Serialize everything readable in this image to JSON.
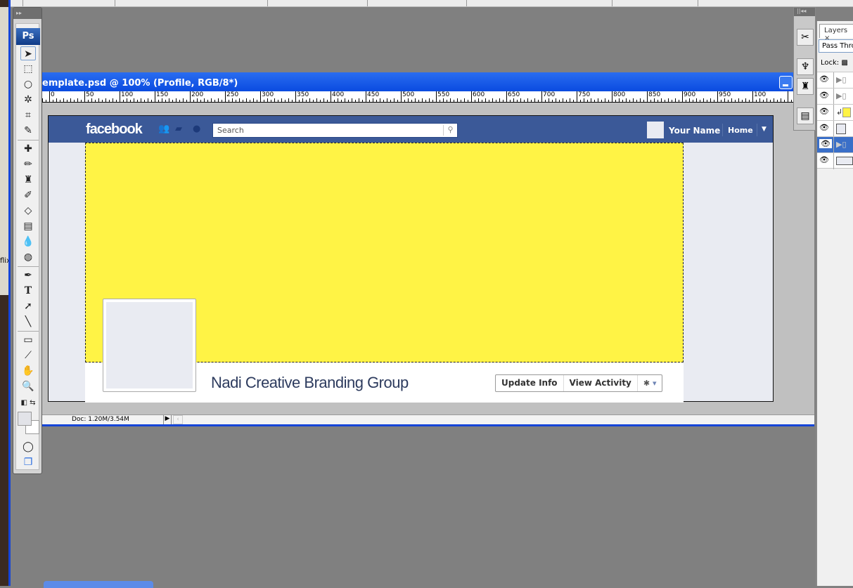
{
  "document": {
    "title": "emplate.psd @ 100% (Profile, RGB/8*)",
    "ruler_labels": [
      "0",
      "50",
      "100",
      "150",
      "200",
      "250",
      "300",
      "350",
      "400",
      "450",
      "500",
      "550",
      "600",
      "650",
      "700",
      "750",
      "800",
      "850",
      "900",
      "950",
      "100"
    ],
    "status_doc": "Doc: 1.20M/3.54M"
  },
  "desktop": {
    "partial_text": "flix"
  },
  "toolbox": {
    "logo": "Ps",
    "tools": [
      "move-tool",
      "marquee-tool",
      "lasso-tool",
      "magic-wand-tool",
      "crop-tool",
      "eyedropper-slice-tool",
      "healing-brush-tool",
      "brush-tool",
      "clone-stamp-tool",
      "history-brush-tool",
      "eraser-tool",
      "gradient-tool",
      "blur-tool",
      "dodge-tool",
      "pen-tool",
      "type-tool",
      "path-selection-tool",
      "line-tool",
      "notes-tool",
      "eyedropper-tool",
      "hand-tool",
      "zoom-tool"
    ],
    "foreground_color": "#e2e3e8",
    "background_color": "#ffffff"
  },
  "facebook": {
    "logo": "facebook",
    "search_placeholder": "Search",
    "user_name": "Your Name",
    "home": "Home",
    "profile_name": "Nadi Creative Branding Group",
    "buttons": {
      "update_info": "Update Info",
      "view_activity": "View Activity"
    },
    "colors": {
      "header": "#3b5998",
      "cover": "#fff345",
      "background": "#e9ebf2"
    }
  },
  "layers_panel": {
    "tab": "Layers",
    "blend_mode": "Pass Throu",
    "lock_label": "Lock:"
  }
}
